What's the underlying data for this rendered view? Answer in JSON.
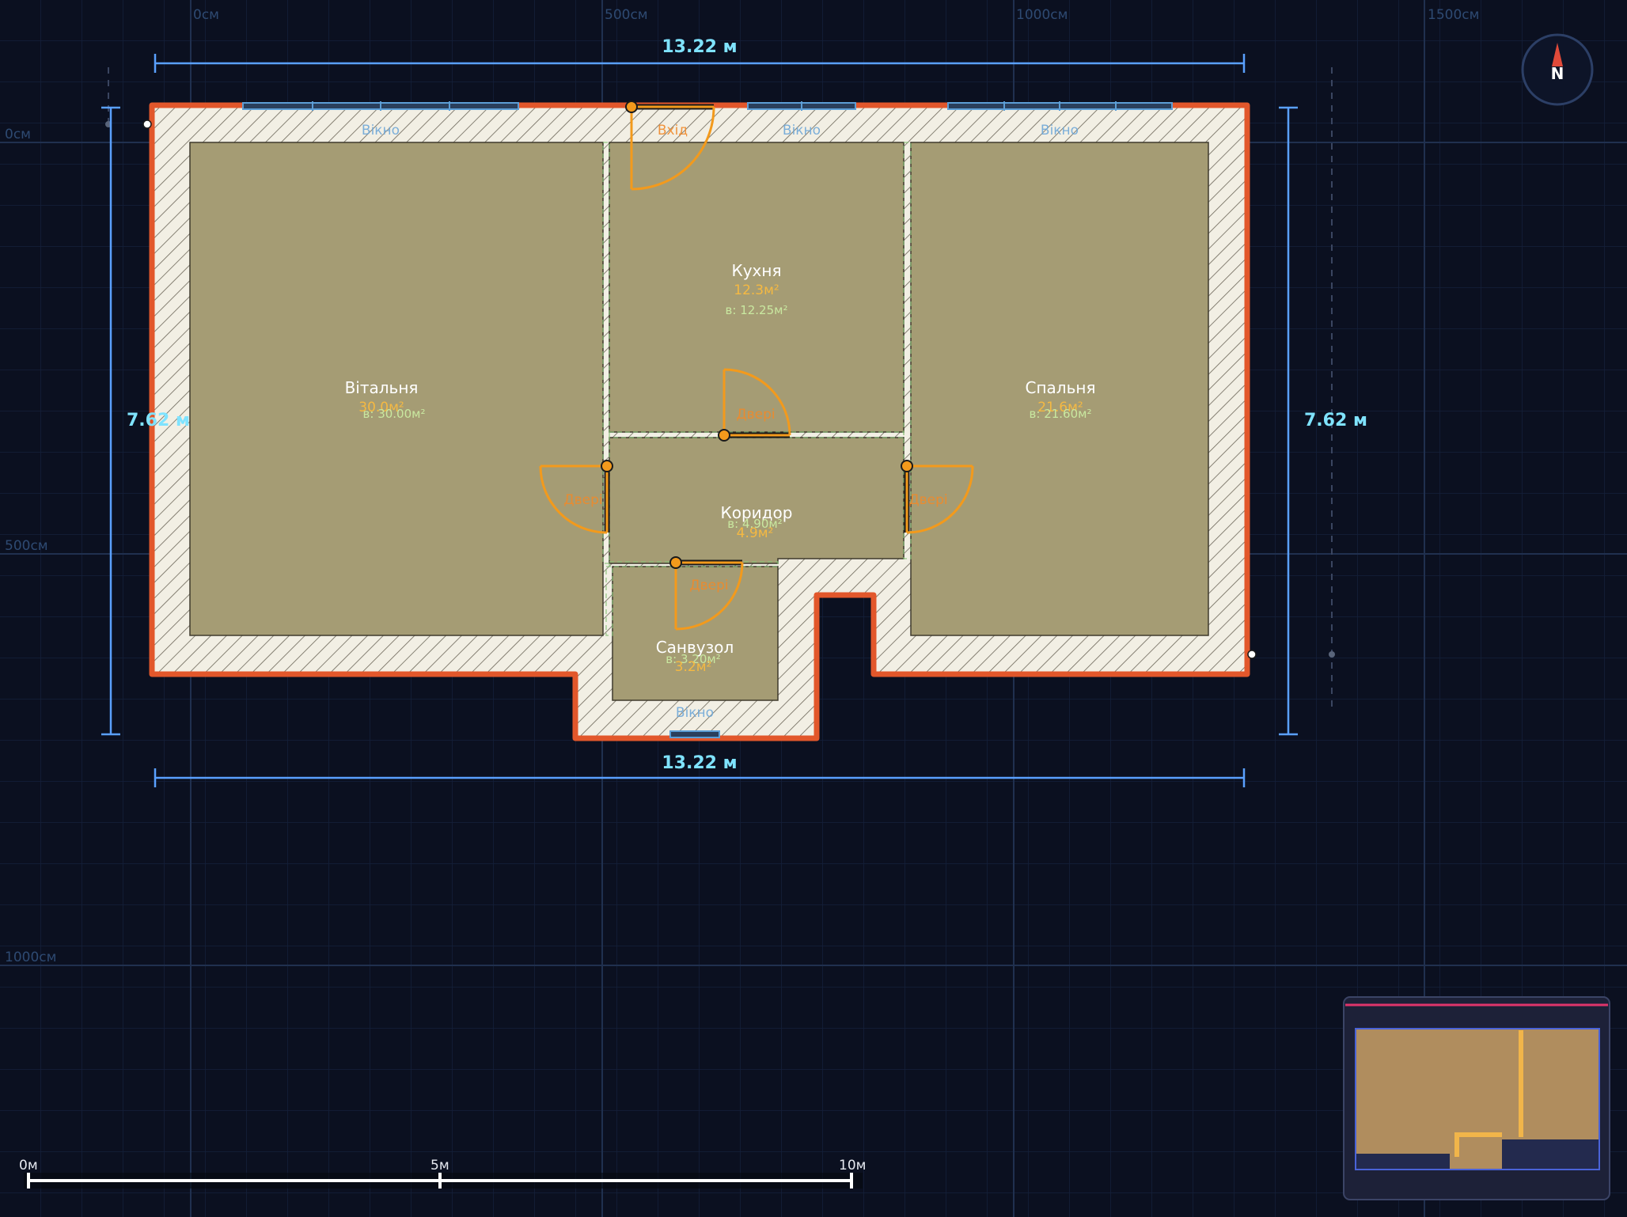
{
  "rulers": {
    "top": [
      "0см",
      "500см",
      "1000см",
      "1500см"
    ],
    "left": [
      "0см",
      "500см",
      "1000см"
    ]
  },
  "dimensions": {
    "top": "13.22 м",
    "bottom": "13.22 м",
    "left": "7.62 м",
    "right": "7.62 м"
  },
  "rooms": [
    {
      "name": "Вітальня",
      "area": "30.0м²",
      "inner": "в: 30.00м²"
    },
    {
      "name": "Кухня",
      "area": "12.3м²",
      "inner": "в: 12.25м²"
    },
    {
      "name": "Спальня",
      "area": "21.6м²",
      "inner": "в: 21.60м²"
    },
    {
      "name": "Коридор",
      "area": "4.9м²",
      "inner": "в: 4.90м²"
    },
    {
      "name": "Санвузол",
      "area": "3.2м²",
      "inner": "в: 3.20м²"
    }
  ],
  "openings": {
    "entry": "Вхід",
    "door": "Двері",
    "window": "Вікно"
  },
  "compass": {
    "label": "N"
  },
  "scale_bar": {
    "labels": [
      "0м",
      "5м",
      "10м"
    ]
  },
  "colors": {
    "background": "#0b1020",
    "grid": "#1a2740",
    "outer_wall": "#e2572b",
    "wall_fill": "#f2efe4",
    "room_fill": "#a59c74",
    "door": "#f39a1c",
    "window": "#5c9ed6",
    "dimension": "#5aa0ff",
    "dimension_text": "#7fe3ff"
  },
  "icons": [
    "compass-icon",
    "hatch-pattern"
  ]
}
